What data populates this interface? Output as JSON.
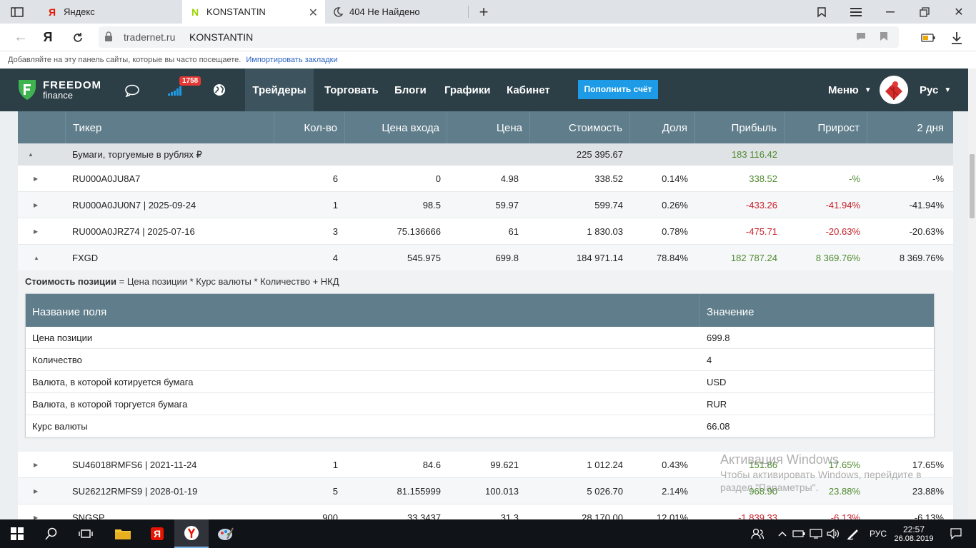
{
  "browser": {
    "tabs": [
      {
        "label": "Яндекс"
      },
      {
        "label": "KONSTANTIN"
      },
      {
        "label": "404 Не Найдено"
      }
    ],
    "url_domain": "tradernet.ru",
    "url_title": "KONSTANTIN",
    "bookmarks_hint": "Добавляйте на эту панель сайты, которые вы часто посещаете.",
    "bookmarks_import": "Импортировать закладки"
  },
  "site": {
    "logo_top": "FREEDOM",
    "logo_bottom": "finance",
    "notif_count": "1758",
    "nav": [
      "Трейдеры",
      "Торговать",
      "Блоги",
      "Графики",
      "Кабинет"
    ],
    "topup_label": "Пополнить счёт",
    "menu_label": "Меню",
    "lang_label": "Рус"
  },
  "table": {
    "headers": [
      "Тикер",
      "Кол-во",
      "Цена входа",
      "Цена",
      "Стоимость",
      "Доля",
      "Прибыль",
      "Прирост",
      "2 дня"
    ],
    "group": {
      "label": "Бумаги, торгуемые в рублях ₽",
      "value": "225 395.67",
      "profit": "183 116.42"
    },
    "rows_top": [
      {
        "ticker": "RU000A0JU8A7",
        "qty": "6",
        "entry": "0",
        "price": "4.98",
        "value": "338.52",
        "share": "0.14%",
        "profit": "338.52",
        "growth": "-%",
        "two_days": "-%",
        "sign": "pos"
      },
      {
        "ticker": "RU000A0JU0N7 | 2025-09-24",
        "qty": "1",
        "entry": "98.5",
        "price": "59.97",
        "value": "599.74",
        "share": "0.26%",
        "profit": "-433.26",
        "growth": "-41.94%",
        "two_days": "-41.94%",
        "sign": "neg"
      },
      {
        "ticker": "RU000A0JRZ74 | 2025-07-16",
        "qty": "3",
        "entry": "75.136666",
        "price": "61",
        "value": "1 830.03",
        "share": "0.78%",
        "profit": "-475.71",
        "growth": "-20.63%",
        "two_days": "-20.63%",
        "sign": "neg"
      },
      {
        "ticker": "FXGD",
        "qty": "4",
        "entry": "545.975",
        "price": "699.8",
        "value": "184 971.14",
        "share": "78.84%",
        "profit": "182 787.24",
        "growth": "8 369.76%",
        "two_days": "8 369.76%",
        "sign": "pos"
      }
    ],
    "rows_bottom": [
      {
        "ticker": "SU46018RMFS6 | 2021-11-24",
        "qty": "1",
        "entry": "84.6",
        "price": "99.621",
        "value": "1 012.24",
        "share": "0.43%",
        "profit": "151.86",
        "growth": "17.65%",
        "two_days": "17.65%",
        "sign": "pos"
      },
      {
        "ticker": "SU26212RMFS9 | 2028-01-19",
        "qty": "5",
        "entry": "81.155999",
        "price": "100.013",
        "value": "5 026.70",
        "share": "2.14%",
        "profit": "968.90",
        "growth": "23.88%",
        "two_days": "23.88%",
        "sign": "pos"
      },
      {
        "ticker": "SNGSP",
        "qty": "900",
        "entry": "33.3437",
        "price": "31.3",
        "value": "28 170.00",
        "share": "12.01%",
        "profit": "-1 839.33",
        "growth": "-6.13%",
        "two_days": "-6.13%",
        "sign": "neg"
      }
    ]
  },
  "detail": {
    "formula_bold": "Стоимость позиции",
    "formula_rest": "= Цена позиции * Курс валюты * Количество + НКД",
    "col_name": "Название поля",
    "col_value": "Значение",
    "rows": [
      {
        "name": "Цена позиции",
        "value": "699.8"
      },
      {
        "name": "Количество",
        "value": "4"
      },
      {
        "name": "Валюта, в которой котируется бумага",
        "value": "USD"
      },
      {
        "name": "Валюта, в которой торгуется бумага",
        "value": "RUR"
      },
      {
        "name": "Курс валюты",
        "value": "66.08"
      }
    ]
  },
  "watermark": {
    "line1": "Активация Windows",
    "line2": "Чтобы активировать Windows, перейдите в",
    "line3": "раздел \"Параметры\"."
  },
  "taskbar": {
    "lang": "РУС",
    "time": "22:57",
    "date": "26.08.2019"
  },
  "colors": {
    "header_bg": "#2c3e46",
    "table_head": "#5f7d8b",
    "accent": "#1e9be6",
    "positive": "#4f8a2e",
    "negative": "#c8202b"
  }
}
